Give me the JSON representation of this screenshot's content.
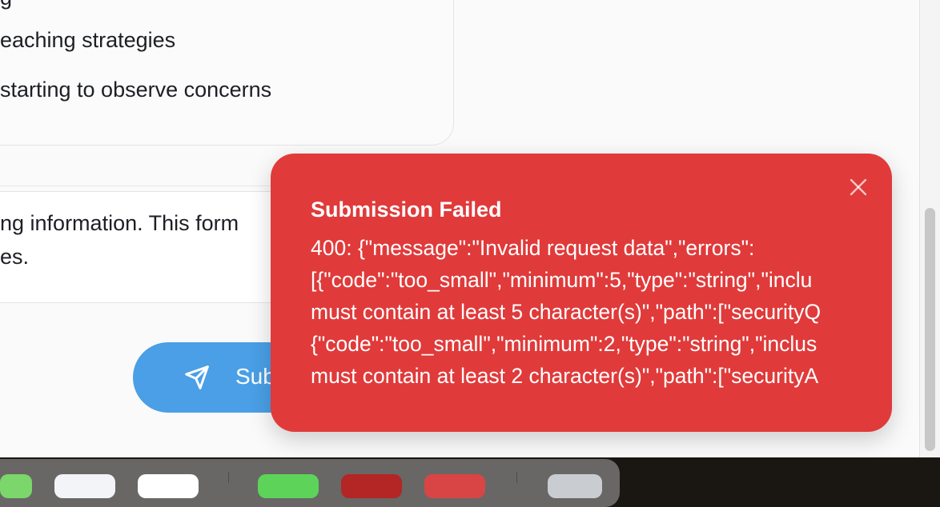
{
  "list": {
    "items": [
      "g",
      "eaching strategies",
      "starting to observe concerns"
    ]
  },
  "info": {
    "line1": "ng information. This form",
    "line2": "es."
  },
  "submit": {
    "label": "Sub",
    "icon": "send-icon"
  },
  "toast": {
    "title": "Submission Failed",
    "lines": [
      "400: {\"message\":\"Invalid request data\",\"errors\":",
      "[{\"code\":\"too_small\",\"minimum\":5,\"type\":\"string\",\"inclu",
      "must contain at least 5 character(s)\",\"path\":[\"securityQ",
      "{\"code\":\"too_small\",\"minimum\":2,\"type\":\"string\",\"inclus",
      "must contain at least 2 character(s)\",\"path\":[\"securityA"
    ],
    "close_icon": "close-icon"
  },
  "colors": {
    "toast_bg": "#e03a3a",
    "button_bg": "#4a9fe6",
    "text": "#1d1f24"
  }
}
